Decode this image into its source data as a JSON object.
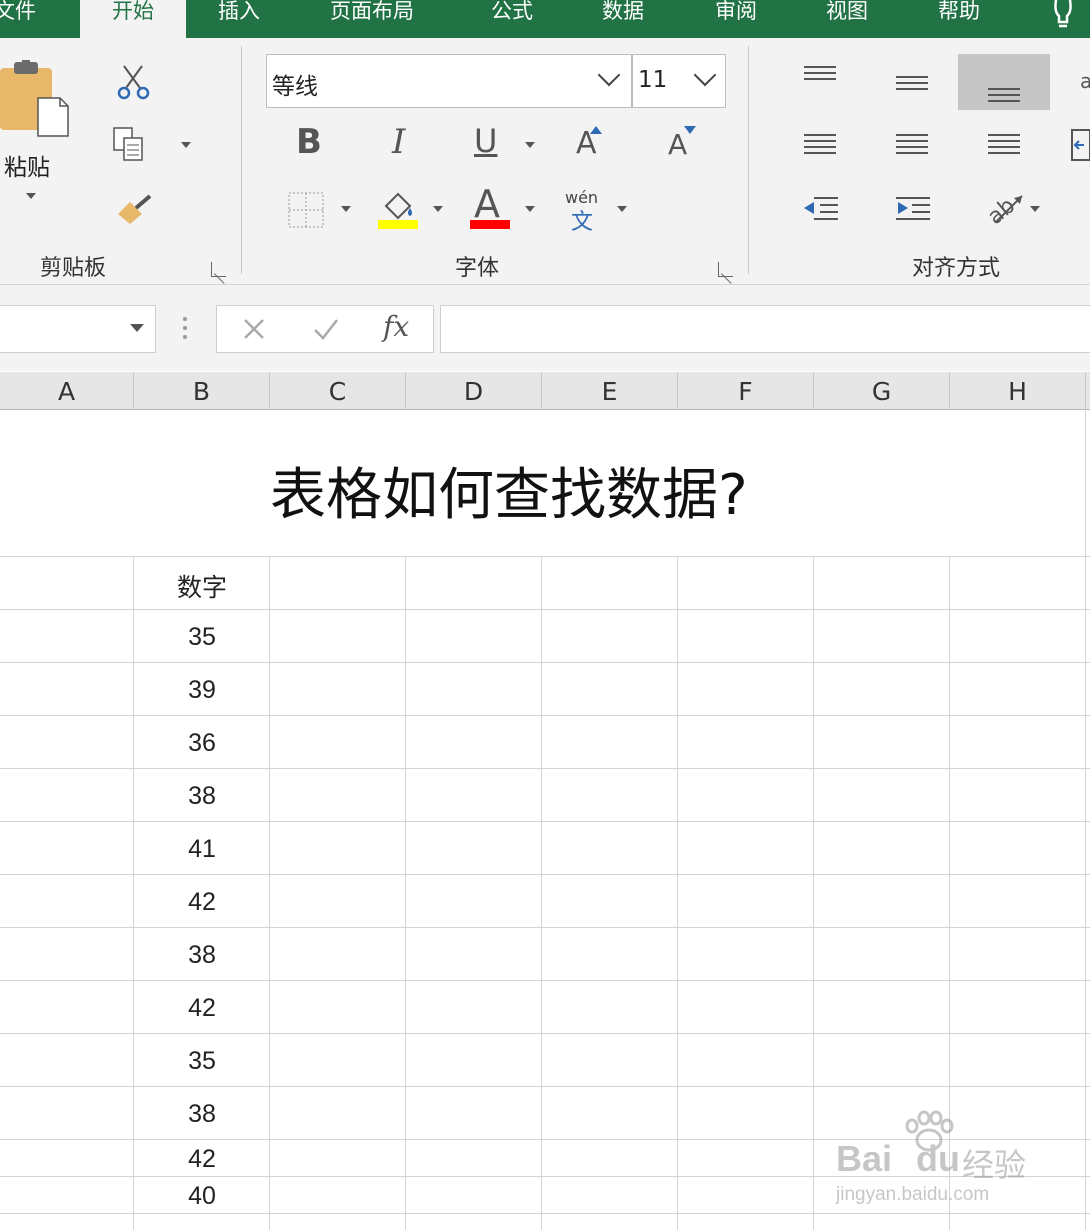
{
  "tabs": [
    {
      "label": "文件",
      "active": false
    },
    {
      "label": "开始",
      "active": true
    },
    {
      "label": "插入",
      "active": false
    },
    {
      "label": "页面布局",
      "active": false
    },
    {
      "label": "公式",
      "active": false
    },
    {
      "label": "数据",
      "active": false
    },
    {
      "label": "审阅",
      "active": false
    },
    {
      "label": "视图",
      "active": false
    },
    {
      "label": "帮助",
      "active": false
    }
  ],
  "ribbon": {
    "clipboard": {
      "paste_label": "粘贴",
      "group_label": "剪贴板"
    },
    "font": {
      "font_name": "等线",
      "font_size": "11",
      "bold": "B",
      "italic": "I",
      "underline": "U",
      "grow": "A",
      "shrink": "A",
      "font_color_glyph": "A",
      "phonetic_top": "wén",
      "phonetic_bottom": "文",
      "group_label": "字体"
    },
    "alignment": {
      "group_label": "对齐方式"
    }
  },
  "formula_bar": {
    "fx": "fx",
    "value": ""
  },
  "columns": [
    "A",
    "B",
    "C",
    "D",
    "E",
    "F",
    "G",
    "H"
  ],
  "sheet": {
    "title": "表格如何查找数据?",
    "header": "数字",
    "values": [
      "35",
      "39",
      "36",
      "38",
      "41",
      "42",
      "38",
      "42",
      "35",
      "38",
      "42",
      "40"
    ]
  },
  "watermark": {
    "brand": "Bai",
    "brand2": "du",
    "product": "经验",
    "url": "jingyan.baidu.com"
  },
  "colors": {
    "excel_green": "#217346",
    "highlight_yellow": "#ffff00",
    "font_red": "#ff0000"
  }
}
